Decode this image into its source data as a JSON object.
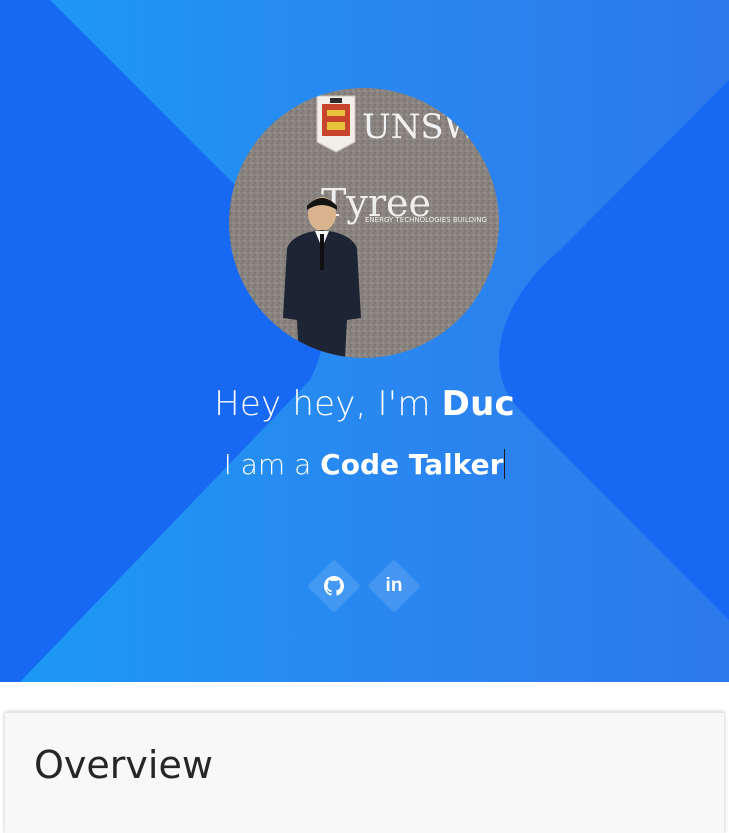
{
  "hero": {
    "greeting_prefix": "Hey hey, I'm ",
    "greeting_name": "Duc",
    "role_prefix": "I am a ",
    "role_name": "Code Talker",
    "avatar_alt": "Profile photo",
    "avatar_sign": {
      "top": "UNSW",
      "building": "Tyree",
      "building_sub": "ENERGY TECHNOLOGIES BUILDING"
    }
  },
  "social": [
    {
      "name": "GitHub",
      "icon": "github-icon"
    },
    {
      "name": "LinkedIn",
      "icon": "linkedin-icon",
      "glyph": "in"
    }
  ],
  "overview": {
    "title": "Overview"
  },
  "colors": {
    "hero_light": "#1a9af5",
    "hero_dark": "#1768f2",
    "text_white": "#ffffff",
    "card_bg": "#f8f8f8"
  }
}
